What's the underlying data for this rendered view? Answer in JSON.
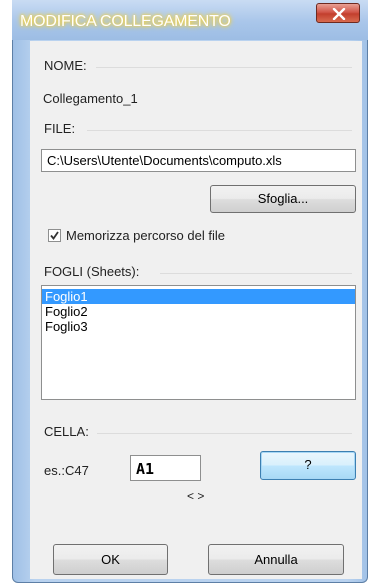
{
  "window": {
    "title": "MODIFICA COLLEGAMENTO",
    "close_icon": "close-icon"
  },
  "nome": {
    "label": "NOME:",
    "value": "Collegamento_1"
  },
  "file": {
    "label": "FILE:",
    "path": "C:\\Users\\Utente\\Documents\\computo.xls",
    "browse_label": "Sfoglia..."
  },
  "remember": {
    "label": "Memorizza percorso del file",
    "checked": true
  },
  "sheets": {
    "label": "FOGLI (Sheets):",
    "items": [
      "Foglio1",
      "Foglio2",
      "Foglio3"
    ],
    "selected": "Foglio1"
  },
  "cella": {
    "label": "CELLA:",
    "example": "es.:C47",
    "value": "A1",
    "help_label": "?",
    "nav": "< >"
  },
  "footer": {
    "ok_label": "OK",
    "cancel_label": "Annulla"
  }
}
